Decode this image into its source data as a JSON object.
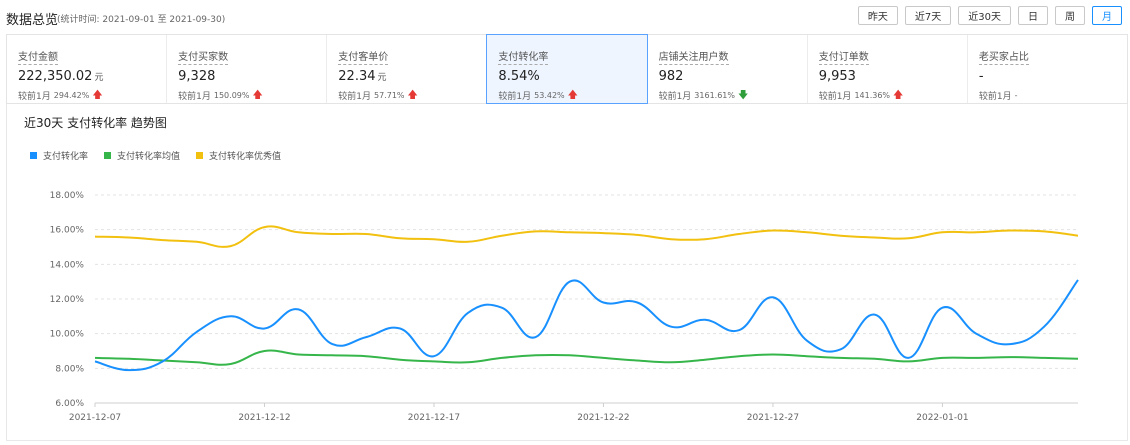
{
  "header": {
    "title": "数据总览",
    "period": "(统计时间: 2021-09-01 至 2021-09-30)",
    "buttons": [
      "昨天",
      "近7天",
      "近30天",
      "日",
      "周",
      "月"
    ],
    "active_button": "月"
  },
  "metrics": [
    {
      "label": "支付金额",
      "value": "222,350.02",
      "unit": "元",
      "compare_label": "较前1月",
      "compare_value": "294.42%",
      "trend": "up"
    },
    {
      "label": "支付买家数",
      "value": "9,328",
      "unit": "",
      "compare_label": "较前1月",
      "compare_value": "150.09%",
      "trend": "up"
    },
    {
      "label": "支付客单价",
      "value": "22.34",
      "unit": "元",
      "compare_label": "较前1月",
      "compare_value": "57.71%",
      "trend": "up"
    },
    {
      "label": "支付转化率",
      "value": "8.54%",
      "unit": "",
      "compare_label": "较前1月",
      "compare_value": "53.42%",
      "trend": "up",
      "active": true
    },
    {
      "label": "店铺关注用户数",
      "value": "982",
      "unit": "",
      "compare_label": "较前1月",
      "compare_value": "3161.61%",
      "trend": "down"
    },
    {
      "label": "支付订单数",
      "value": "9,953",
      "unit": "",
      "compare_label": "较前1月",
      "compare_value": "141.36%",
      "trend": "up"
    },
    {
      "label": "老买家占比",
      "value": "-",
      "unit": "",
      "compare_label": "较前1月",
      "compare_value": "-",
      "trend": "none"
    }
  ],
  "chart_title": "近30天 支付转化率 趋势图",
  "colors": {
    "accent": "#1890ff",
    "up": "#e53935",
    "down": "#2e9d3a"
  },
  "chart_data": {
    "type": "line",
    "x": [
      "2021-12-07",
      "2021-12-08",
      "2021-12-09",
      "2021-12-10",
      "2021-12-11",
      "2021-12-12",
      "2021-12-13",
      "2021-12-14",
      "2021-12-15",
      "2021-12-16",
      "2021-12-17",
      "2021-12-18",
      "2021-12-19",
      "2021-12-20",
      "2021-12-21",
      "2021-12-22",
      "2021-12-23",
      "2021-12-24",
      "2021-12-25",
      "2021-12-26",
      "2021-12-27",
      "2021-12-28",
      "2021-12-29",
      "2021-12-30",
      "2021-12-31",
      "2022-01-01",
      "2022-01-02",
      "2022-01-03",
      "2022-01-04",
      "2022-01-05"
    ],
    "x_tick_labels": [
      "2021-12-07",
      "2021-12-12",
      "2021-12-17",
      "2021-12-22",
      "2021-12-27",
      "2022-01-01"
    ],
    "y_tick_labels": [
      "6.00%",
      "8.00%",
      "10.00%",
      "12.00%",
      "14.00%",
      "16.00%",
      "18.00%"
    ],
    "ylim": [
      6,
      18
    ],
    "grid": true,
    "legend_position": "top-left",
    "series": [
      {
        "name": "支付转化率",
        "color": "#1890ff",
        "values": [
          8.4,
          7.9,
          8.4,
          10.1,
          11.0,
          10.3,
          11.4,
          9.4,
          9.8,
          10.3,
          8.7,
          11.2,
          11.5,
          9.8,
          13.0,
          11.8,
          11.8,
          10.4,
          10.8,
          10.2,
          12.1,
          9.6,
          9.1,
          11.1,
          8.6,
          11.5,
          10.0,
          9.4,
          10.4,
          13.1
        ]
      },
      {
        "name": "支付转化率均值",
        "color": "#36b64a",
        "values": [
          8.6,
          8.55,
          8.45,
          8.35,
          8.25,
          9.0,
          8.8,
          8.75,
          8.7,
          8.5,
          8.4,
          8.35,
          8.6,
          8.75,
          8.75,
          8.6,
          8.45,
          8.35,
          8.5,
          8.7,
          8.8,
          8.7,
          8.6,
          8.55,
          8.4,
          8.6,
          8.6,
          8.65,
          8.6,
          8.55
        ]
      },
      {
        "name": "支付转化率优秀值",
        "color": "#f2c00f",
        "values": [
          15.6,
          15.55,
          15.4,
          15.3,
          15.05,
          16.15,
          15.85,
          15.75,
          15.75,
          15.5,
          15.45,
          15.3,
          15.65,
          15.9,
          15.85,
          15.8,
          15.7,
          15.45,
          15.45,
          15.75,
          15.95,
          15.85,
          15.65,
          15.55,
          15.5,
          15.85,
          15.85,
          15.95,
          15.9,
          15.65
        ]
      }
    ]
  }
}
